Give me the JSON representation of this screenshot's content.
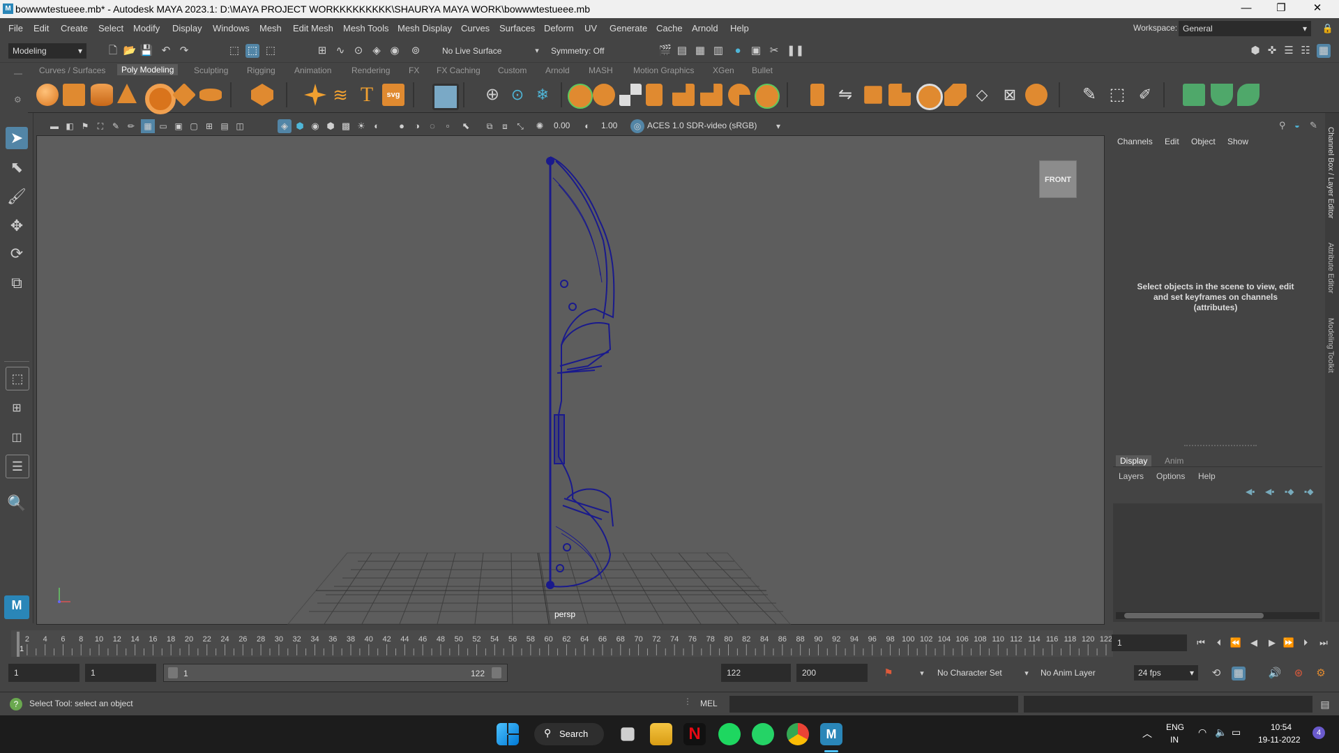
{
  "window": {
    "title": "bowwwtestueee.mb* - Autodesk MAYA 2023.1: D:\\MAYA PROJECT WORKKKKKKKKK\\SHAURYA MAYA WORK\\bowwwtestueee.mb",
    "minimize": "—",
    "maximize": "❐",
    "close": "✕"
  },
  "menubar": {
    "items": [
      "File",
      "Edit",
      "Create",
      "Select",
      "Modify",
      "Display",
      "Windows",
      "Mesh",
      "Edit Mesh",
      "Mesh Tools",
      "Mesh Display",
      "Curves",
      "Surfaces",
      "Deform",
      "UV",
      "Generate",
      "Cache",
      "Arnold",
      "Help"
    ],
    "workspace_label": "Workspace:",
    "workspace_value": "General"
  },
  "statusline": {
    "menuset": "Modeling",
    "live_surface": "No Live Surface",
    "symmetry": "Symmetry: Off"
  },
  "shelf": {
    "tabs": [
      "Curves / Surfaces",
      "Poly Modeling",
      "Sculpting",
      "Rigging",
      "Animation",
      "Rendering",
      "FX",
      "FX Caching",
      "Custom",
      "Arnold",
      "MASH",
      "Motion Graphics",
      "XGen",
      "Bullet"
    ],
    "active_tab": "Poly Modeling"
  },
  "viewport": {
    "exposure": "0.00",
    "gamma": "1.00",
    "color_transform": "ACES 1.0 SDR-video (sRGB)",
    "view_cube_label": "FRONT",
    "camera_label": "persp"
  },
  "channelbox": {
    "menus": [
      "Channels",
      "Edit",
      "Object",
      "Show"
    ],
    "message": "Select objects in the scene to view, edit and set keyframes on channels (attributes)",
    "layer_tabs": [
      "Display",
      "Anim"
    ],
    "layer_menus": [
      "Layers",
      "Options",
      "Help"
    ],
    "side_tabs": [
      "Channel Box / Layer Editor",
      "Attribute Editor",
      "Modeling Toolkit"
    ]
  },
  "timeslider": {
    "ticks": [
      "1",
      "2",
      "4",
      "6",
      "8",
      "10",
      "12",
      "14",
      "16",
      "18",
      "20",
      "22",
      "24",
      "26",
      "28",
      "30",
      "32",
      "34",
      "36",
      "38",
      "40",
      "42",
      "44",
      "46",
      "48",
      "50",
      "52",
      "54",
      "56",
      "58",
      "60",
      "62",
      "64",
      "66",
      "68",
      "70",
      "72",
      "74",
      "76",
      "78",
      "80",
      "82",
      "84",
      "86",
      "88",
      "90",
      "92",
      "94",
      "96",
      "98",
      "100",
      "102",
      "104",
      "106",
      "108",
      "110",
      "112",
      "114",
      "116",
      "118",
      "120",
      "122"
    ],
    "current_frame": "1"
  },
  "rangeslider": {
    "start_time": "1",
    "playback_start": "1",
    "range_start": "1",
    "range_end": "122",
    "playback_end": "122",
    "end_time": "200",
    "character_set": "No Character Set",
    "anim_layer": "No Anim Layer",
    "fps": "24 fps"
  },
  "helpline": {
    "message": "Select Tool: select an object",
    "command_type": "MEL"
  },
  "taskbar": {
    "search_label": "Search",
    "language": "ENG",
    "region": "IN",
    "time": "10:54",
    "date": "19-11-2022",
    "notification_count": "4"
  },
  "colors": {
    "accent": "#5285a6",
    "wireframe": "#1a1a8c",
    "viewport_bg": "#5d5d5d"
  }
}
